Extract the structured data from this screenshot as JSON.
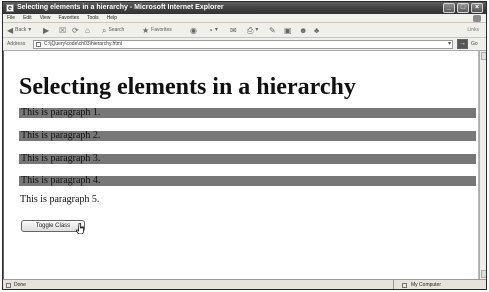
{
  "window": {
    "title": "Selecting elements in a hierarchy - Microsoft Internet Explorer",
    "buttons": [
      "_",
      "□",
      "×"
    ]
  },
  "menu": [
    "File",
    "Edit",
    "View",
    "Favorites",
    "Tools",
    "Help"
  ],
  "toolbar": {
    "back_label": "Back",
    "search_label": "Search",
    "favorites_label": "Favorites",
    "links_label": "Links"
  },
  "address": {
    "label": "Address",
    "url": "C:\\jQuery\\code\\ch03\\hierarchy.html",
    "go_label": "Go"
  },
  "page": {
    "heading": "Selecting elements in a hierarchy",
    "highlighted_paragraphs": [
      "This is paragraph 1.",
      "This is paragraph 2.",
      "This is paragraph 3.",
      "This is paragraph 4."
    ],
    "plain_paragraph": "This is paragraph 5.",
    "button_label": "Toggle Class"
  },
  "status": {
    "left": "Done",
    "zone": "My Computer"
  },
  "colors": {
    "highlight": "#777777"
  },
  "icons": [
    "ie-icon",
    "back-icon",
    "forward-icon",
    "stop-icon",
    "refresh-icon",
    "home-icon",
    "search-icon",
    "favorites-icon",
    "media-icon",
    "mail-icon",
    "print-icon",
    "edit-icon",
    "go-icon",
    "computer-icon"
  ]
}
